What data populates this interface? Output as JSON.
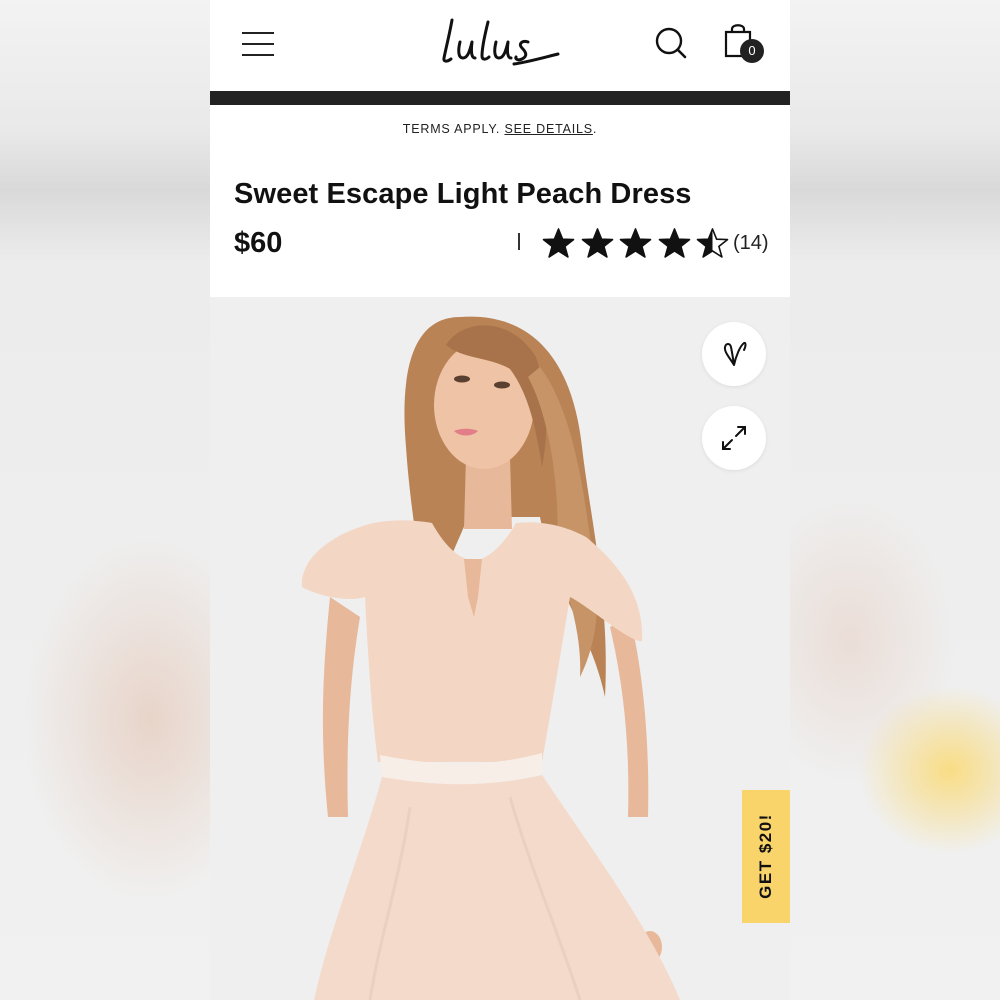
{
  "header": {
    "cart_count": "0"
  },
  "promo": {
    "terms_text": "TERMS APPLY.",
    "details_link": "SEE DETAILS",
    "period": "."
  },
  "product": {
    "title": "Sweet Escape Light Peach Dress",
    "price": "$60",
    "rating": 4.5,
    "rating_max": 5,
    "review_count": "(14)"
  },
  "actions": {
    "get20_label": "GET $20!"
  },
  "colors": {
    "accent_yellow": "#f8d46a",
    "bar_dark": "#222222",
    "dress_peach": "#f3d6c4"
  },
  "icons": [
    "menu-icon",
    "lulus-logo",
    "search-icon",
    "shopping-bag-icon",
    "star-icon",
    "heart-icon",
    "expand-icon"
  ]
}
